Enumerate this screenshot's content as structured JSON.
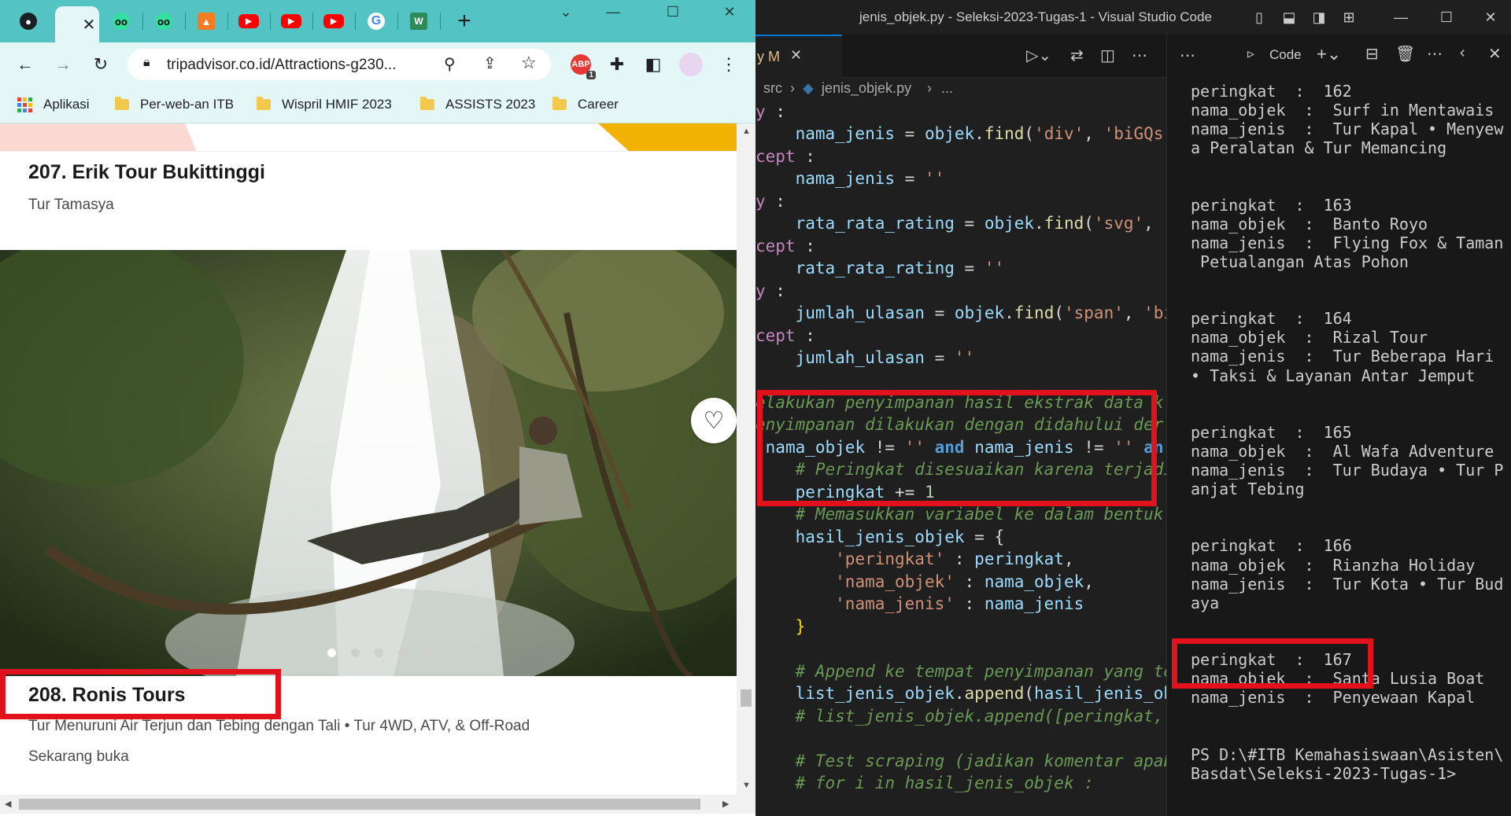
{
  "browser": {
    "tabs": [
      {
        "icon": "github-icon",
        "title": ""
      },
      {
        "icon": "tripadvisor-icon",
        "title": "",
        "active": true
      },
      {
        "icon": "tripadvisor-icon",
        "title": ""
      },
      {
        "icon": "tripadvisor-icon",
        "title": ""
      },
      {
        "icon": "drafts-icon",
        "title": ""
      },
      {
        "icon": "youtube-icon",
        "title": ""
      },
      {
        "icon": "youtube-icon",
        "title": ""
      },
      {
        "icon": "youtube-icon",
        "title": ""
      },
      {
        "icon": "google-icon",
        "title": ""
      },
      {
        "icon": "w3-icon",
        "title": ""
      }
    ],
    "close_glyph": "✕",
    "new_tab_glyph": "+",
    "url": "tripadvisor.co.id/Attractions-g230...",
    "extension_badge": "1",
    "bookmarks": [
      "Aplikasi",
      "Per-web-an ITB",
      "Wispril HMIF 2023",
      "ASSISTS 2023",
      "Career"
    ]
  },
  "listing": {
    "item1_title": "207. Erik Tour Bukittinggi",
    "item1_subtitle": "Tur Tamasya",
    "item2_title": "208. Ronis Tours",
    "item2_subtitle": "Tur Menuruni Air Terjun dan Tebing dengan Tali • Tur 4WD, ATV, & Off-Road",
    "item2_status": "Sekarang buka",
    "carousel_dots": 5,
    "carousel_active": 0
  },
  "vscode": {
    "window_title": "jenis_objek.py - Seleksi-2023-Tugas-1 - Visual Studio Code",
    "tab_fragment": "y M",
    "breadcrumb_folder": "src",
    "breadcrumb_file": "jenis_objek.py",
    "breadcrumb_more": "...",
    "terminal_label": "Code",
    "terminal_lines": [
      "peringkat  :  162",
      "nama_objek  :  Surf in Mentawais",
      "nama_jenis  :  Tur Kapal • Menyew",
      "a Peralatan & Tur Memancing",
      "",
      "",
      "peringkat  :  163",
      "nama_objek  :  Banto Royo",
      "nama_jenis  :  Flying Fox & Taman",
      " Petualangan Atas Pohon",
      "",
      "",
      "peringkat  :  164",
      "nama_objek  :  Rizal Tour",
      "nama_jenis  :  Tur Beberapa Hari",
      "• Taksi & Layanan Antar Jemput",
      "",
      "",
      "peringkat  :  165",
      "nama_objek  :  Al Wafa Adventure",
      "nama_jenis  :  Tur Budaya • Tur P",
      "anjat Tebing",
      "",
      "",
      "peringkat  :  166",
      "nama_objek  :  Rianzha Holiday",
      "nama_jenis  :  Tur Kota • Tur Bud",
      "aya",
      "",
      "",
      "peringkat  :  167",
      "nama_objek  :  Santa Lusia Boat",
      "nama_jenis  :  Penyewaan Kapal",
      "",
      "",
      "PS D:\\#ITB Kemahasiswaan\\Asisten\\",
      "Basdat\\Seleksi-2023-Tugas-1>"
    ]
  }
}
